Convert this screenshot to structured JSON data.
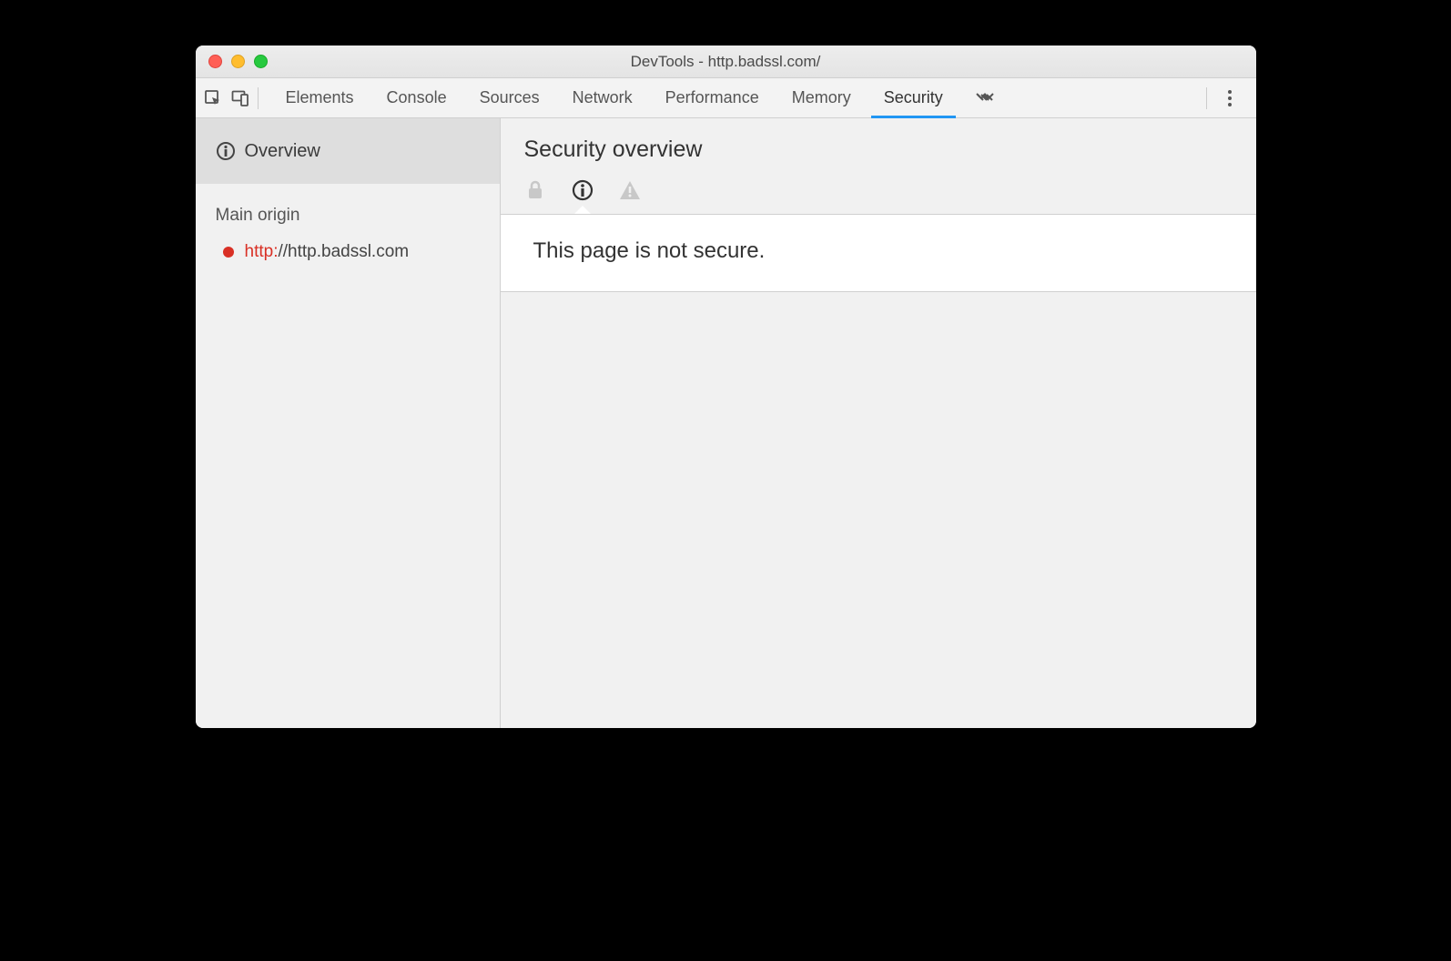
{
  "window": {
    "title": "DevTools - http.badssl.com/"
  },
  "tabs": {
    "items": [
      {
        "label": "Elements"
      },
      {
        "label": "Console"
      },
      {
        "label": "Sources"
      },
      {
        "label": "Network"
      },
      {
        "label": "Performance"
      },
      {
        "label": "Memory"
      },
      {
        "label": "Security"
      }
    ],
    "active_index": 6
  },
  "sidebar": {
    "overview_label": "Overview",
    "section_label": "Main origin",
    "origin": {
      "scheme": "http:",
      "rest": "//http.badssl.com",
      "status_color": "#d93025"
    }
  },
  "main": {
    "heading": "Security overview",
    "message": "This page is not secure."
  }
}
